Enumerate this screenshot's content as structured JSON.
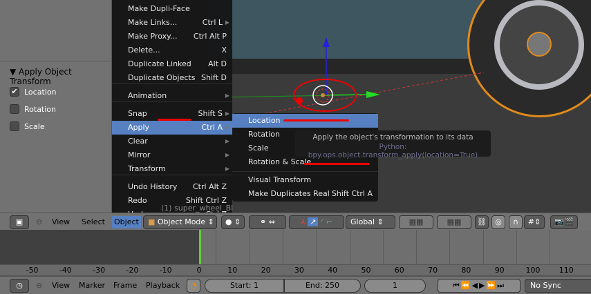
{
  "viewport": {
    "object_label": "(1) super_wheel_Bl"
  },
  "panel": {
    "title": "Apply Object Transform",
    "options": [
      {
        "label": "Location",
        "checked": true
      },
      {
        "label": "Rotation",
        "checked": false
      },
      {
        "label": "Scale",
        "checked": false
      }
    ]
  },
  "menu": {
    "items": [
      {
        "label": "Make Dupli-Face",
        "shortcut": "",
        "submenu": false
      },
      {
        "label": "Make Links...",
        "shortcut": "Ctrl L",
        "submenu": true
      },
      {
        "label": "Make Proxy...",
        "shortcut": "Ctrl Alt P",
        "submenu": false
      },
      {
        "label": "Delete...",
        "shortcut": "X",
        "submenu": false
      },
      {
        "label": "Duplicate Linked",
        "shortcut": "Alt D",
        "submenu": false
      },
      {
        "label": "Duplicate Objects",
        "shortcut": "Shift D",
        "submenu": false
      },
      {
        "label": "Animation",
        "shortcut": "",
        "submenu": true
      },
      {
        "label": "Snap",
        "shortcut": "Shift S",
        "submenu": true
      },
      {
        "label": "Apply",
        "shortcut": "Ctrl A",
        "submenu": true
      },
      {
        "label": "Clear",
        "shortcut": "",
        "submenu": true
      },
      {
        "label": "Mirror",
        "shortcut": "",
        "submenu": true
      },
      {
        "label": "Transform",
        "shortcut": "",
        "submenu": true
      },
      {
        "label": "Undo History",
        "shortcut": "Ctrl Alt Z",
        "submenu": false
      },
      {
        "label": "Redo",
        "shortcut": "Shift Ctrl Z",
        "submenu": false
      },
      {
        "label": "Undo",
        "shortcut": "Ctrl Z",
        "submenu": false
      }
    ]
  },
  "submenu": {
    "items": [
      {
        "label": "Location",
        "shortcut": ""
      },
      {
        "label": "Rotation",
        "shortcut": ""
      },
      {
        "label": "Scale",
        "shortcut": ""
      },
      {
        "label": "Rotation & Scale",
        "shortcut": ""
      },
      {
        "label": "Visual Transform",
        "shortcut": ""
      },
      {
        "label": "Make Duplicates Real",
        "shortcut": "Shift Ctrl A"
      }
    ]
  },
  "tooltip": {
    "text": "Apply the object's transformation to its data",
    "python": "Python: bpy.ops.object.transform_apply(location=True)"
  },
  "header3d": {
    "view": "View",
    "select": "Select",
    "object": "Object",
    "mode": "Object Mode",
    "orientation": "Global"
  },
  "timeline": {
    "ticks": [
      "-50",
      "-40",
      "-30",
      "-20",
      "-10",
      "0",
      "10",
      "20",
      "30",
      "40",
      "50",
      "60",
      "70",
      "80",
      "90",
      "100",
      "110"
    ],
    "current_frame_value": 1
  },
  "footer": {
    "view": "View",
    "marker": "Marker",
    "frame": "Frame",
    "playback": "Playback",
    "start": "Start: 1",
    "end": "End: 250",
    "current": "1",
    "sync": "No Sync"
  },
  "colors": {
    "highlight": "#5680c2",
    "current_frame": "#5fcf3a"
  }
}
